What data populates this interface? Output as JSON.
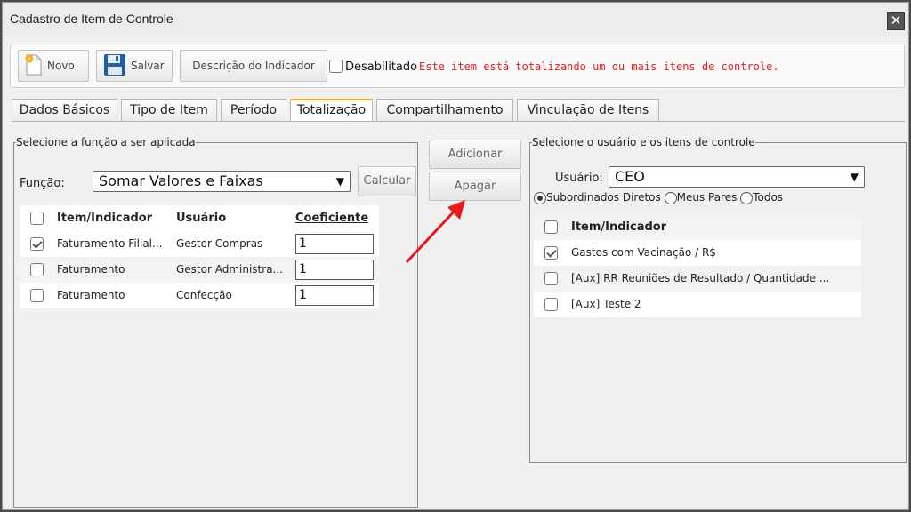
{
  "window": {
    "title": "Cadastro de Item de Controle",
    "close_glyph": "✕"
  },
  "toolbar": {
    "new_label": "Novo",
    "save_label": "Salvar",
    "description_label": "Descrição do Indicador",
    "disabled_label": "Desabilitado",
    "disabled_checked": false,
    "warning_text": "Este item está totalizando um ou mais itens de controle.",
    "warning_color": "#e02020"
  },
  "tabs": [
    {
      "label": "Dados Básicos",
      "active": false
    },
    {
      "label": "Tipo de Item",
      "active": false
    },
    {
      "label": "Período",
      "active": false
    },
    {
      "label": "Totalização",
      "active": true
    },
    {
      "label": "Compartilhamento",
      "active": false
    },
    {
      "label": "Vinculação de Itens",
      "active": false
    }
  ],
  "left_panel": {
    "legend": "Selecione a função a ser aplicada",
    "function_label": "Função:",
    "function_value": "Somar Valores e Faixas",
    "calc_label": "Calcular",
    "headers": {
      "item": "Item/Indicador",
      "user": "Usuário",
      "coef": "Coeficiente"
    },
    "rows": [
      {
        "checked": true,
        "item": "Faturamento Filial...",
        "user": "Gestor Compras",
        "coef": "1"
      },
      {
        "checked": false,
        "item": "Faturamento",
        "user": "Gestor Administra...",
        "coef": "1"
      },
      {
        "checked": false,
        "item": "Faturamento",
        "user": "Confecção",
        "coef": "1"
      }
    ]
  },
  "middle": {
    "add_label": "Adicionar",
    "remove_label": "Apagar",
    "arrow_color": "#e8191c"
  },
  "right_panel": {
    "legend": "Selecione o usuário e os itens de controle",
    "user_label": "Usuário:",
    "user_value": "CEO",
    "radios": [
      {
        "label": "Subordinados Diretos",
        "checked": true
      },
      {
        "label": "Meus Pares",
        "checked": false
      },
      {
        "label": "Todos",
        "checked": false
      }
    ],
    "header": "Item/Indicador",
    "rows": [
      {
        "checked": true,
        "item": "Gastos com Vacinação / R$"
      },
      {
        "checked": false,
        "item": "[Aux] RR Reuniões de Resultado / Quantidade ..."
      },
      {
        "checked": false,
        "item": "[Aux] Teste 2"
      }
    ]
  }
}
